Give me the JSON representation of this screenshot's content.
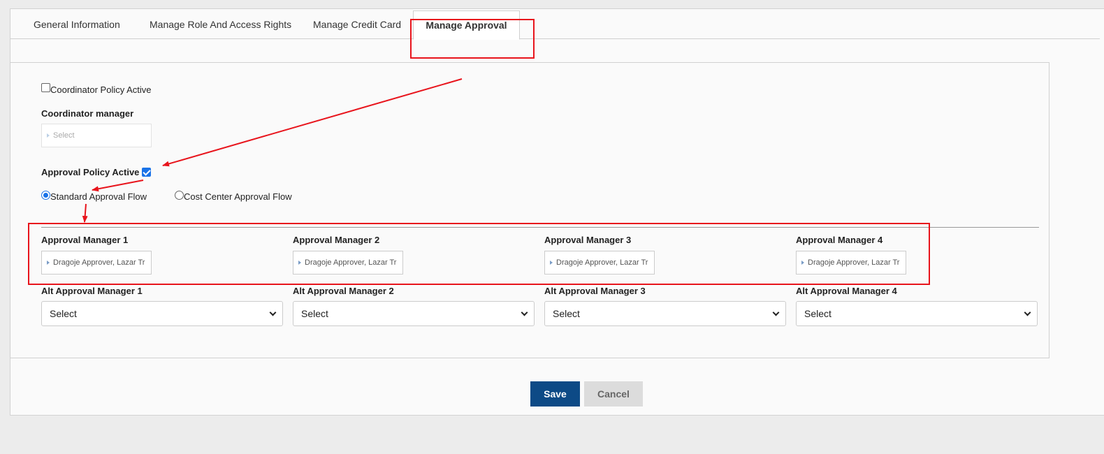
{
  "tabs": [
    {
      "label": "General Information",
      "active": false
    },
    {
      "label": "Manage Role And Access Rights",
      "active": false
    },
    {
      "label": "Manage Credit Card",
      "active": false
    },
    {
      "label": "Manage Approval",
      "active": true
    }
  ],
  "coordinator": {
    "policy_label": "Coordinator Policy Active",
    "policy_checked": false,
    "manager_label": "Coordinator manager",
    "manager_placeholder": "Select"
  },
  "approval": {
    "policy_label": "Approval Policy Active",
    "policy_checked": true,
    "flows": [
      {
        "label": "Standard Approval Flow",
        "selected": true
      },
      {
        "label": "Cost Center Approval Flow",
        "selected": false
      }
    ],
    "managers": [
      {
        "label": "Approval Manager 1",
        "value": "Dragoje Approver, Lazar Tr"
      },
      {
        "label": "Approval Manager 2",
        "value": "Dragoje Approver, Lazar Tr"
      },
      {
        "label": "Approval Manager 3",
        "value": "Dragoje Approver, Lazar Tr"
      },
      {
        "label": "Approval Manager 4",
        "value": "Dragoje Approver, Lazar Tr"
      }
    ],
    "alt_managers": [
      {
        "label": "Alt Approval Manager 1",
        "value": "Select"
      },
      {
        "label": "Alt Approval Manager 2",
        "value": "Select"
      },
      {
        "label": "Alt Approval Manager 3",
        "value": "Select"
      },
      {
        "label": "Alt Approval Manager 4",
        "value": "Select"
      }
    ]
  },
  "actions": {
    "save_label": "Save",
    "cancel_label": "Cancel"
  },
  "colors": {
    "accent": "#0d4a86",
    "annotation": "#e8141c",
    "checkbox": "#1a73e8"
  }
}
